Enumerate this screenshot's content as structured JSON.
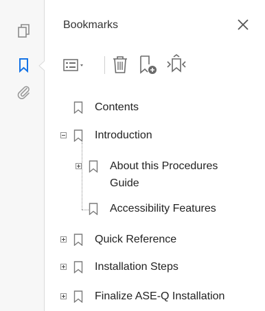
{
  "panel": {
    "title": "Bookmarks",
    "close_label": "Close"
  },
  "left_strip": {
    "icons": [
      "pages-icon",
      "bookmark-icon",
      "attachment-icon"
    ],
    "active_color": "#1473e6"
  },
  "toolbar": {
    "icons": [
      "options-menu-icon",
      "delete-bookmark-icon",
      "new-bookmark-icon",
      "expand-bookmark-icon"
    ]
  },
  "bookmarks": [
    {
      "label": "Contents",
      "level": 0,
      "expander": "none"
    },
    {
      "label": "Introduction",
      "level": 0,
      "expander": "minus"
    },
    {
      "label": "About this Procedures",
      "label_line2": "Guide",
      "level": 1,
      "expander": "plus"
    },
    {
      "label": "Accessibility Features",
      "level": 1,
      "expander": "none"
    },
    {
      "label": "Quick Reference",
      "level": 0,
      "expander": "plus"
    },
    {
      "label": "Installation Steps",
      "level": 0,
      "expander": "plus"
    },
    {
      "label": "Finalize ASE-Q Installation",
      "level": 0,
      "expander": "plus"
    }
  ]
}
